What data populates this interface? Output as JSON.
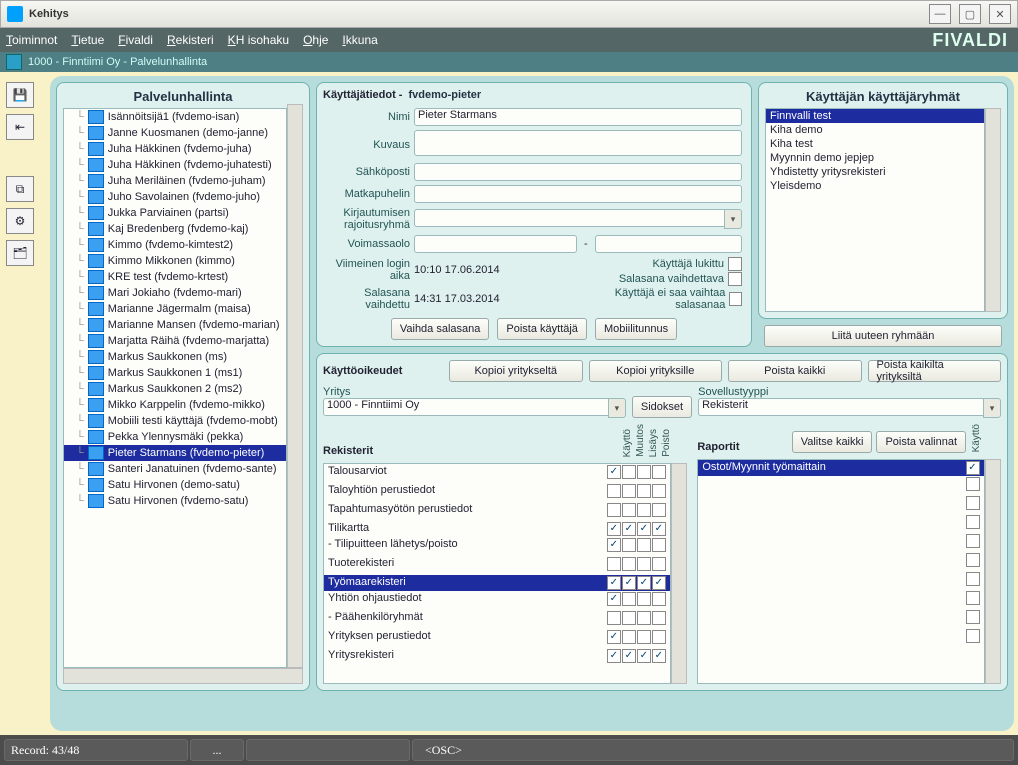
{
  "window_title": "Kehitys",
  "menu": [
    "Toiminnot",
    "Tietue",
    "Fivaldi",
    "Rekisteri",
    "KH isohaku",
    "Ohje",
    "Ikkuna"
  ],
  "brand": "FIVALDI",
  "subheader": "1000 - Finntiimi Oy - Palvelunhallinta",
  "sidebar": {
    "title": "Palvelunhallinta",
    "users": [
      "Isännöitsijä1 (fvdemo-isan)",
      "Janne Kuosmanen (demo-janne)",
      "Juha Häkkinen (fvdemo-juha)",
      "Juha Häkkinen (fvdemo-juhatesti)",
      "Juha Meriläinen (fvdemo-juham)",
      "Juho Savolainen (fvdemo-juho)",
      "Jukka Parviainen (partsi)",
      "Kaj Bredenberg (fvdemo-kaj)",
      "Kimmo (fvdemo-kimtest2)",
      "Kimmo Mikkonen (kimmo)",
      "KRE test (fvdemo-krtest)",
      "Mari Jokiaho (fvdemo-mari)",
      "Marianne Jägermalm (maisa)",
      "Marianne Mansen (fvdemo-marian)",
      "Marjatta Räihä (fvdemo-marjatta)",
      "Markus Saukkonen (ms)",
      "Markus Saukkonen 1 (ms1)",
      "Markus Saukkonen 2 (ms2)",
      "Mikko Karppelin (fvdemo-mikko)",
      "Mobiili testi käyttäjä (fvdemo-mobt)",
      "Pekka Ylennysmäki (pekka)",
      "Pieter Starmans (fvdemo-pieter)",
      "Santeri Janatuinen (fvdemo-sante)",
      "Satu Hirvonen (demo-satu)",
      "Satu Hirvonen (fvdemo-satu)"
    ],
    "selected": 21
  },
  "details": {
    "section_title": "Käyttäjätiedot -",
    "username": "fvdemo-pieter",
    "labels": {
      "name": "Nimi",
      "desc": "Kuvaus",
      "email": "Sähköposti",
      "phone": "Matkapuhelin",
      "loginrestrict": "Kirjautumisen rajoitusryhmä",
      "valid": "Voimassaolo",
      "lastlogin": "Viimeinen login aika",
      "pwchanged": "Salasana vaihdettu"
    },
    "values": {
      "name": "Pieter Starmans",
      "lastlogin": "10:10 17.06.2014",
      "pwchanged": "14:31 17.03.2014"
    },
    "flags": {
      "locked": "Käyttäjä lukittu",
      "mustchange": "Salasana vaihdettava",
      "nopwself": "Käyttäjä ei saa vaihtaa salasanaa"
    },
    "buttons": {
      "chpw": "Vaihda salasana",
      "deluser": "Poista käyttäjä",
      "mobile": "Mobiilitunnus"
    }
  },
  "groups": {
    "title": "Käyttäjän käyttäjäryhmät",
    "items": [
      "Finnvalli test",
      "Kiha demo",
      "Kiha test",
      "Myynnin demo jepjep",
      "Yhdistetty yritysrekisteri",
      "Yleisdemo"
    ],
    "selected": 0,
    "add_button": "Liitä uuteen ryhmään"
  },
  "perms": {
    "title": "Käyttöoikeudet",
    "buttons": {
      "copyfrom": "Kopioi yritykseltä",
      "copyto": "Kopioi yrityksille",
      "clearall": "Poista kaikki",
      "clearallcomp": "Poista kaikilta yrityksiltä"
    },
    "company_label": "Yritys",
    "company": "1000 - Finntiimi Oy",
    "sidokset": "Sidokset",
    "apptype_label": "Sovellustyyppi",
    "apptype": "Rekisterit",
    "cols": [
      "Käyttö",
      "Muutos",
      "Lisäys",
      "Poisto"
    ],
    "left_title": "Rekisterit",
    "rows": [
      {
        "name": "Talousarviot",
        "c": [
          true,
          false,
          false,
          false
        ]
      },
      {
        "name": "Taloyhtiön perustiedot",
        "c": [
          false,
          false,
          false,
          false
        ]
      },
      {
        "name": "Tapahtumasyötön perustiedot",
        "c": [
          false,
          false,
          false,
          false
        ]
      },
      {
        "name": "Tilikartta",
        "c": [
          true,
          true,
          true,
          true
        ]
      },
      {
        "name": "- Tilipuitteen lähetys/poisto",
        "c": [
          true,
          false,
          false,
          false
        ]
      },
      {
        "name": "Tuoterekisteri",
        "c": [
          false,
          false,
          false,
          false
        ]
      },
      {
        "name": "Työmaarekisteri",
        "c": [
          true,
          true,
          true,
          true
        ],
        "sel": true
      },
      {
        "name": "Yhtiön ohjaustiedot",
        "c": [
          true,
          false,
          false,
          false
        ]
      },
      {
        "name": "- Päähenkilöryhmät",
        "c": [
          false,
          false,
          false,
          false
        ]
      },
      {
        "name": "Yrityksen perustiedot",
        "c": [
          true,
          false,
          false,
          false
        ]
      },
      {
        "name": "Yritysrekisteri",
        "c": [
          true,
          true,
          true,
          true
        ]
      }
    ],
    "reports": {
      "title": "Raportit",
      "selall": "Valitse kaikki",
      "clearsel": "Poista valinnat",
      "col": "Käyttö",
      "rows": [
        {
          "name": "Ostot/Myynnit työmaittain",
          "c": true,
          "sel": true
        }
      ]
    }
  },
  "status": {
    "record": "Record: 43/48",
    "osc": "<OSC>"
  }
}
